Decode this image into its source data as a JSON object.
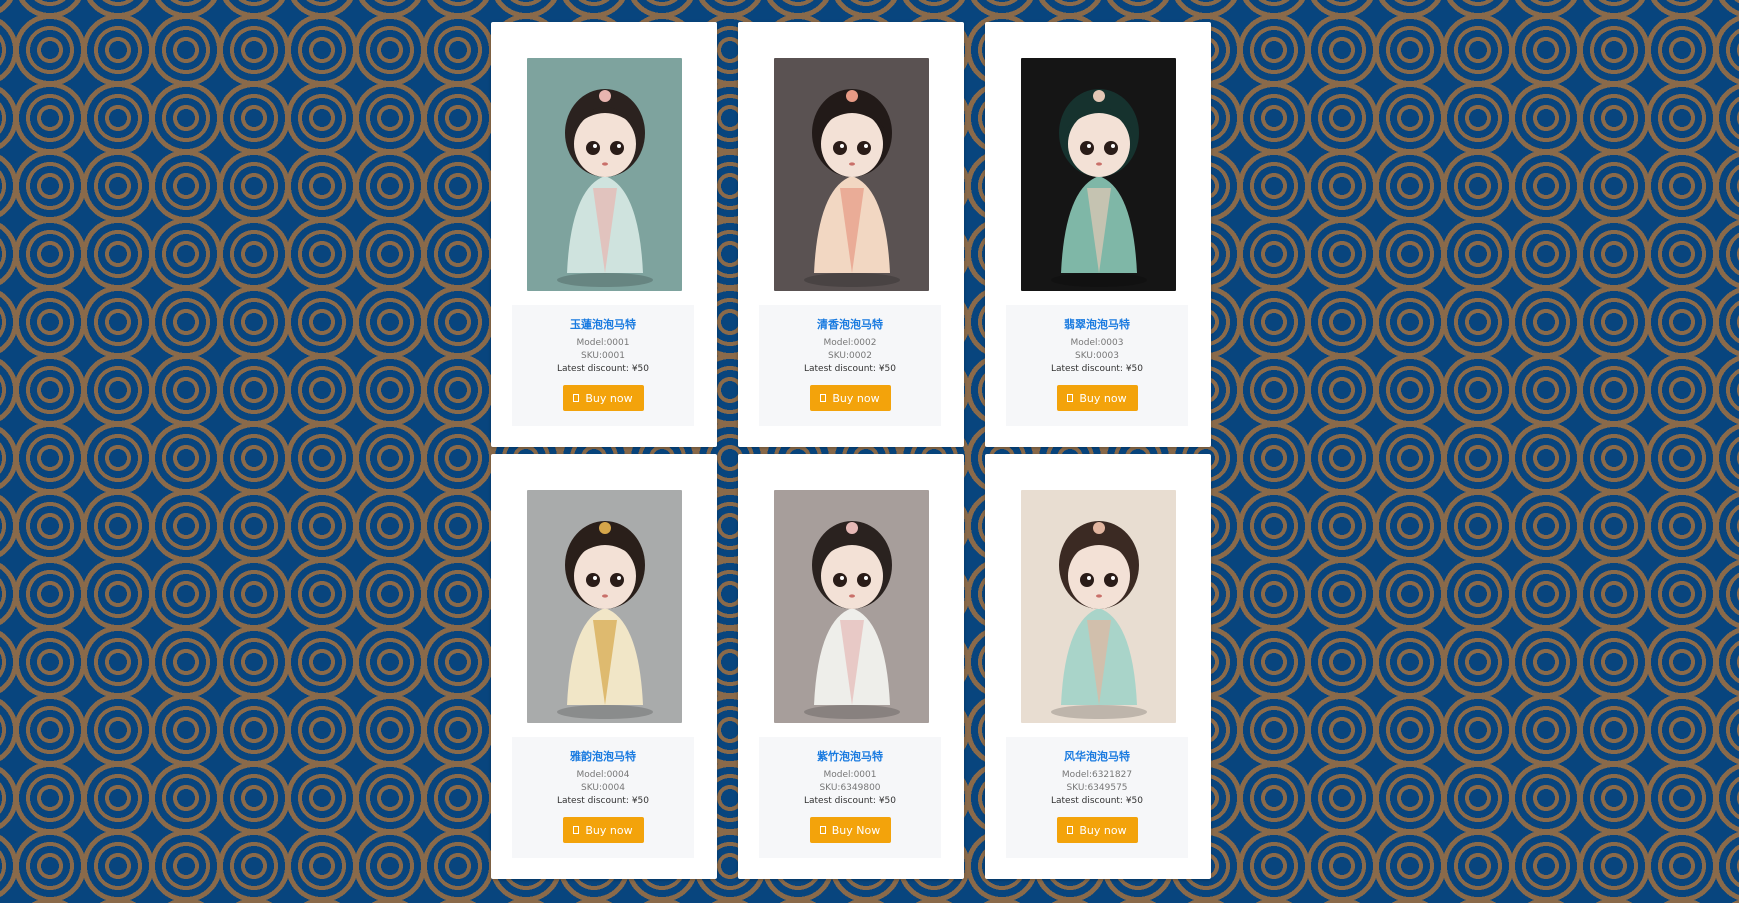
{
  "products": [
    {
      "name": "玉蓮泡泡马特",
      "model": "Model:0001",
      "sku": "SKU:0001",
      "discount": "Latest discount: ¥50",
      "button": "Buy now",
      "palette": {
        "bg": "#7ea39e",
        "robe": "#cfe3de",
        "accent": "#e8b5b0",
        "hair": "#2b221f"
      }
    },
    {
      "name": "清香泡泡马特",
      "model": "Model:0002",
      "sku": "SKU:0002",
      "discount": "Latest discount: ¥50",
      "button": "Buy now",
      "palette": {
        "bg": "#5a5252",
        "robe": "#f2d7c2",
        "accent": "#e79a85",
        "hair": "#221a18"
      }
    },
    {
      "name": "翡翠泡泡马特",
      "model": "Model:0003",
      "sku": "SKU:0003",
      "discount": "Latest discount: ¥50",
      "button": "Buy now",
      "palette": {
        "bg": "#151515",
        "robe": "#7fb7a7",
        "accent": "#e3c7b5",
        "hair": "#16322e"
      }
    },
    {
      "name": "雅韵泡泡马特",
      "model": "Model:0004",
      "sku": "SKU:0004",
      "discount": "Latest discount: ¥50",
      "button": "Buy now",
      "palette": {
        "bg": "#a9abab",
        "robe": "#f1e6c7",
        "accent": "#d6a64a",
        "hair": "#2a1f1a"
      }
    },
    {
      "name": "紫竹泡泡马特",
      "model": "Model:0001",
      "sku": "SKU:6349800",
      "discount": "Latest discount: ¥50",
      "button": "Buy Now",
      "palette": {
        "bg": "#a79e9b",
        "robe": "#eeeeea",
        "accent": "#e6b9b6",
        "hair": "#2a221f"
      }
    },
    {
      "name": "风华泡泡马特",
      "model": "Model:6321827",
      "sku": "SKU:6349575",
      "discount": "Latest discount: ¥50",
      "button": "Buy now",
      "palette": {
        "bg": "#e8ddd1",
        "robe": "#a9d4c9",
        "accent": "#e2b6a0",
        "hair": "#3b2a23"
      }
    }
  ],
  "icons": {
    "cart": "shopping-cart-icon"
  }
}
